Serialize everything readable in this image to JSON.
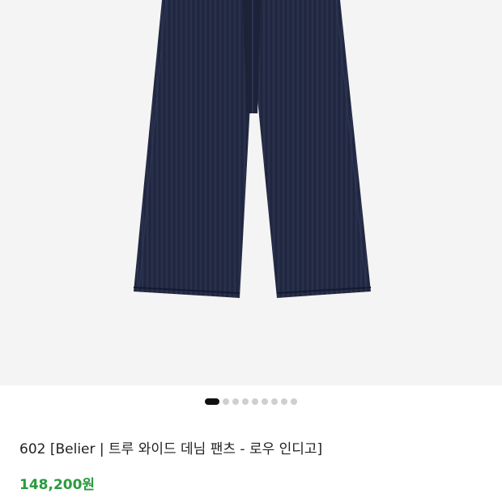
{
  "product": {
    "image_alt": "jeans-photo",
    "title": "602 [Belier | 트루 와이드 데님 팬츠 - 로우 인디고]",
    "price": "148,200원"
  },
  "carousel": {
    "total": 9,
    "active_index": 0
  },
  "colors": {
    "price": "#2a9a3f",
    "denim": "#232a44",
    "dot_active": "#111111",
    "dot_inactive": "#cfcfcf"
  }
}
